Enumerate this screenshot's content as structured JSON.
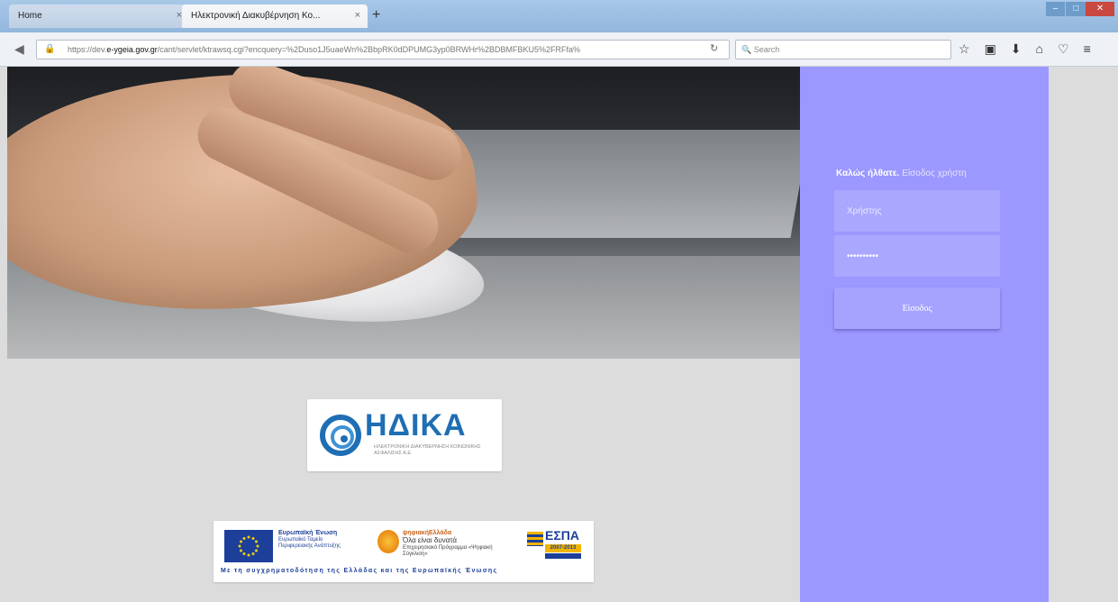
{
  "browser": {
    "tabs": [
      {
        "label": "Home",
        "active": false
      },
      {
        "label": "Ηλεκτρονική Διακυβέρνηση Κο...",
        "active": true
      }
    ],
    "new_tab_label": "+",
    "tab_close_label": "×",
    "url_prefix": "https://dev.",
    "url_domain": "e-ygeia.gov.gr",
    "url_rest": "/cant/servlet/ktrawsq.cgi?encquery=%2Duso1J5uaeWn%2BbpRK0dDPUMG3yp0BRWHr%2BDBMFBKU5%2FRFfa%",
    "search_placeholder": "Search",
    "toolbar_icons": [
      "star-icon",
      "clipboard-icon",
      "download-icon",
      "home-icon",
      "pocket-icon",
      "menu-icon"
    ]
  },
  "login": {
    "welcome_bold": "Καλώς ήλθατε.",
    "welcome_sub": "Είσοδος χρήστη",
    "username_placeholder": "Χρήστης",
    "password_value": "••••••••••",
    "submit_label": "Είσοδος"
  },
  "logo": {
    "name": "ΗΔΙΚΑ",
    "tagline": "ΗΛΕΚΤΡΟΝΙΚΗ ΔΙΑΚΥΒΕΡΝΗΣΗ ΚΟΙΝΩΝΙΚΗΣ ΑΣΦΑΛΙΣΗΣ Α.Ε."
  },
  "eu_banner": {
    "eu_title": "Ευρωπαϊκή Ένωση",
    "eu_sub": "Ευρωπαϊκό Ταμείο Περιφερειακής Ανάπτυξης",
    "digital_title": "ψηφιακήΕλλάδα",
    "digital_slogan": "Όλα είναι δυνατά",
    "digital_sub": "Επιχειρησιακό Πρόγραμμα «Ψηφιακή Σύγκλιση»",
    "espa_title": "ΕΣΠΑ",
    "espa_years": "2007-2013",
    "footer": "Με τη συγχρηματοδότηση της Ελλάδας και της Ευρωπαϊκής Ένωσης"
  },
  "colors": {
    "login_panel": "#9b98ff",
    "page_bg": "#dcdcdc",
    "brand_blue": "#1f6eb4"
  }
}
